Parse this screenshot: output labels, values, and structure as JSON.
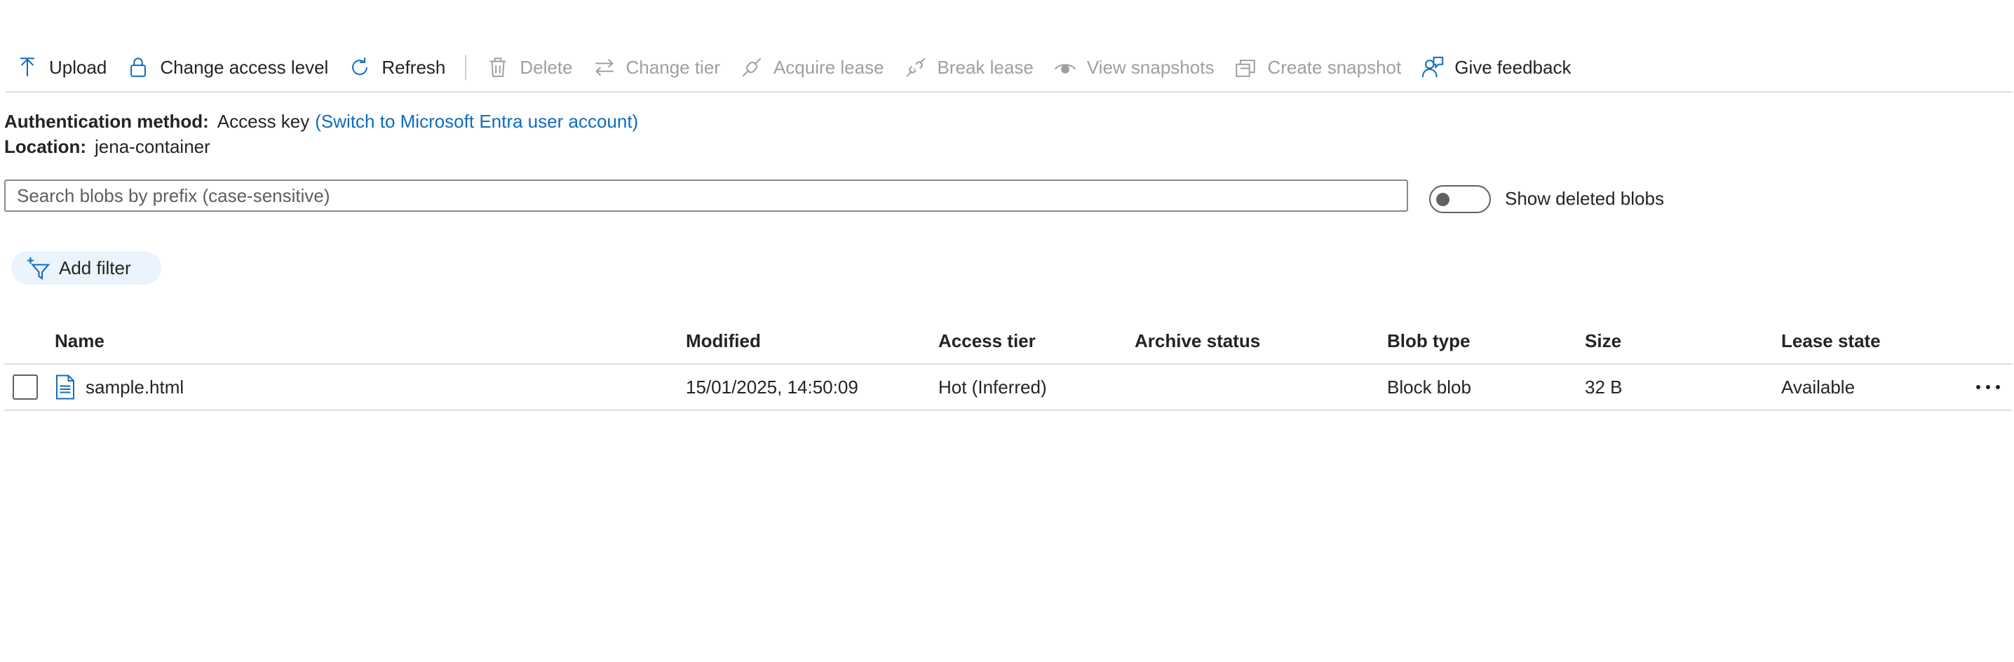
{
  "toolbar": {
    "items": [
      {
        "label": "Upload",
        "icon": "upload-icon",
        "enabled": true
      },
      {
        "label": "Change access level",
        "icon": "lock-icon",
        "enabled": true
      },
      {
        "label": "Refresh",
        "icon": "refresh-icon",
        "enabled": true
      },
      {
        "label": "Delete",
        "icon": "trash-icon",
        "enabled": false
      },
      {
        "label": "Change tier",
        "icon": "swap-arrows-icon",
        "enabled": false
      },
      {
        "label": "Acquire lease",
        "icon": "link-icon",
        "enabled": false
      },
      {
        "label": "Break lease",
        "icon": "broken-link-icon",
        "enabled": false
      },
      {
        "label": "View snapshots",
        "icon": "eye-icon",
        "enabled": false
      },
      {
        "label": "Create snapshot",
        "icon": "snapshot-icon",
        "enabled": false
      },
      {
        "label": "Give feedback",
        "icon": "feedback-icon",
        "enabled": true
      }
    ]
  },
  "info": {
    "auth_label": "Authentication method:",
    "auth_value": "Access key",
    "auth_link": "(Switch to Microsoft Entra user account)",
    "location_label": "Location:",
    "location_value": "jena-container"
  },
  "search": {
    "placeholder": "Search blobs by prefix (case-sensitive)",
    "value": ""
  },
  "show_deleted": {
    "label": "Show deleted blobs",
    "on": false
  },
  "filter": {
    "label": "Add filter"
  },
  "table": {
    "columns": {
      "name": "Name",
      "modified": "Modified",
      "tier": "Access tier",
      "archive": "Archive status",
      "type": "Blob type",
      "size": "Size",
      "lease": "Lease state"
    },
    "rows": [
      {
        "name": "sample.html",
        "modified": "15/01/2025, 14:50:09",
        "tier": "Hot (Inferred)",
        "archive": "",
        "type": "Block blob",
        "size": "32 B",
        "lease": "Available"
      }
    ]
  },
  "colors": {
    "accent": "#0f6cbd",
    "text": "#242424",
    "disabled": "#a19f9d",
    "filter_bg": "#ebf3fc"
  }
}
